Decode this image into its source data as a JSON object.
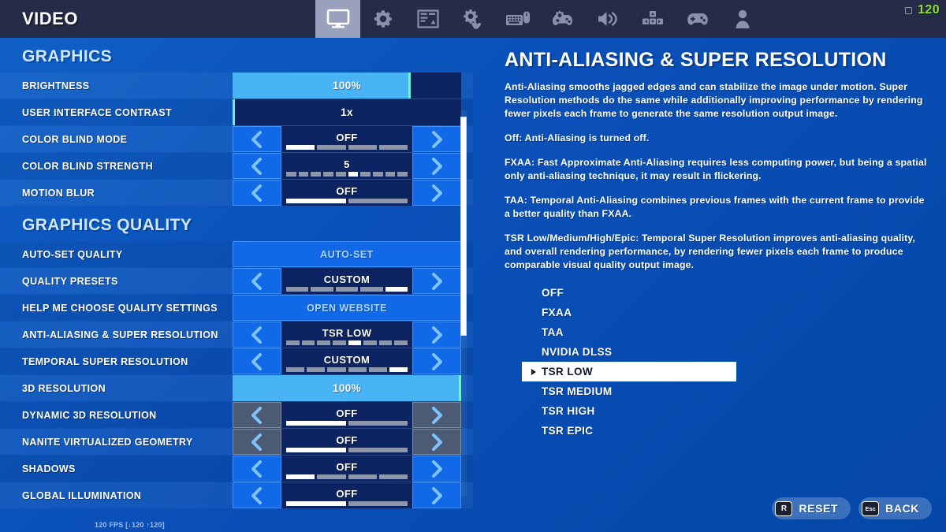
{
  "header": {
    "title": "VIDEO",
    "fps_counter": "120",
    "tabs": [
      {
        "name": "video",
        "icon": "monitor-icon",
        "active": true
      },
      {
        "name": "game",
        "icon": "gear-icon",
        "active": false
      },
      {
        "name": "brightness-hud",
        "icon": "hud-layout-icon",
        "active": false
      },
      {
        "name": "touch",
        "icon": "gear-hand-icon",
        "active": false
      },
      {
        "name": "keyboard-mouse",
        "icon": "keyboard-mouse-icon",
        "active": false
      },
      {
        "name": "controller-options",
        "icon": "controller-gear-icon",
        "active": false
      },
      {
        "name": "audio",
        "icon": "speaker-icon",
        "active": false
      },
      {
        "name": "input-keys",
        "icon": "dpad-keys-icon",
        "active": false
      },
      {
        "name": "controller",
        "icon": "gamepad-icon",
        "active": false
      },
      {
        "name": "account",
        "icon": "person-icon",
        "active": false
      }
    ],
    "window_controls": {
      "minimize": "minimize-icon",
      "maximize": "maximize-icon"
    }
  },
  "sections": [
    {
      "title": "GRAPHICS",
      "rows": [
        {
          "label": "BRIGHTNESS",
          "type": "slider",
          "value": "100%",
          "fill_pct": 78,
          "disabled": false
        },
        {
          "label": "USER INTERFACE CONTRAST",
          "type": "slider",
          "value": "1x",
          "fill_pct": 0,
          "disabled": false
        },
        {
          "label": "COLOR BLIND MODE",
          "type": "stepper",
          "value": "OFF",
          "segments": 4,
          "active_segment": 1,
          "disabled": false
        },
        {
          "label": "COLOR BLIND STRENGTH",
          "type": "stepper",
          "value": "5",
          "segments": 10,
          "active_segment": 6,
          "disabled": false
        },
        {
          "label": "MOTION BLUR",
          "type": "stepper",
          "value": "OFF",
          "segments": 2,
          "active_segment": 1,
          "disabled": false
        }
      ]
    },
    {
      "title": "GRAPHICS QUALITY",
      "rows": [
        {
          "label": "AUTO-SET QUALITY",
          "type": "button",
          "value": "AUTO-SET",
          "disabled": false
        },
        {
          "label": "QUALITY PRESETS",
          "type": "stepper",
          "value": "CUSTOM",
          "segments": 5,
          "active_segment": 5,
          "disabled": false
        },
        {
          "label": "HELP ME CHOOSE QUALITY SETTINGS",
          "type": "button",
          "value": "OPEN WEBSITE",
          "disabled": false
        },
        {
          "label": "ANTI-ALIASING & SUPER RESOLUTION",
          "type": "stepper",
          "value": "TSR LOW",
          "segments": 8,
          "active_segment": 5,
          "disabled": false
        },
        {
          "label": "TEMPORAL SUPER RESOLUTION",
          "type": "stepper",
          "value": "CUSTOM",
          "segments": 6,
          "active_segment": 6,
          "disabled": false
        },
        {
          "label": "3D RESOLUTION",
          "type": "slider",
          "value": "100%",
          "fill_pct": 100,
          "disabled": false
        },
        {
          "label": "DYNAMIC 3D RESOLUTION",
          "type": "stepper",
          "value": "OFF",
          "segments": 2,
          "active_segment": 1,
          "disabled": true
        },
        {
          "label": "NANITE VIRTUALIZED GEOMETRY",
          "type": "stepper",
          "value": "OFF",
          "segments": 2,
          "active_segment": 1,
          "disabled": true
        },
        {
          "label": "SHADOWS",
          "type": "stepper",
          "value": "OFF",
          "segments": 4,
          "active_segment": 1,
          "disabled": false
        },
        {
          "label": "GLOBAL ILLUMINATION",
          "type": "stepper",
          "value": "OFF",
          "segments": 2,
          "active_segment": 1,
          "disabled": false
        }
      ]
    }
  ],
  "fps_overlay": "120 FPS [↓120 ↑120]",
  "detail": {
    "title": "ANTI-ALIASING & SUPER RESOLUTION",
    "paragraphs": [
      "Anti-Aliasing smooths jagged edges and can stabilize the image under motion. Super Resolution methods do the same while additionally improving performance by rendering fewer pixels each frame to generate the same resolution output image.",
      "Off: Anti-Aliasing is turned off.",
      "FXAA: Fast Approximate Anti-Aliasing requires less computing power, but being a spatial only anti-aliasing technique, it may result in flickering.",
      "TAA: Temporal Anti-Aliasing combines previous frames with the current frame to provide a better quality than FXAA.",
      "TSR Low/Medium/High/Epic: Temporal Super Resolution improves anti-aliasing quality, and overall rendering performance, by rendering fewer pixels each frame to produce comparable visual quality output image."
    ],
    "options": [
      {
        "label": "OFF",
        "selected": false
      },
      {
        "label": "FXAA",
        "selected": false
      },
      {
        "label": "TAA",
        "selected": false
      },
      {
        "label": "NVIDIA DLSS",
        "selected": false
      },
      {
        "label": "TSR LOW",
        "selected": true
      },
      {
        "label": "TSR MEDIUM",
        "selected": false
      },
      {
        "label": "TSR HIGH",
        "selected": false
      },
      {
        "label": "TSR EPIC",
        "selected": false
      }
    ]
  },
  "footer": {
    "reset": {
      "key": "R",
      "label": "RESET"
    },
    "back": {
      "key": "Esc",
      "label": "BACK"
    }
  },
  "colors": {
    "accent_blue": "#1169e8",
    "slider_fill": "#49b4f5",
    "panel_dark": "#0d2463",
    "topbar": "#262b47",
    "fps_green": "#8fe02a"
  }
}
